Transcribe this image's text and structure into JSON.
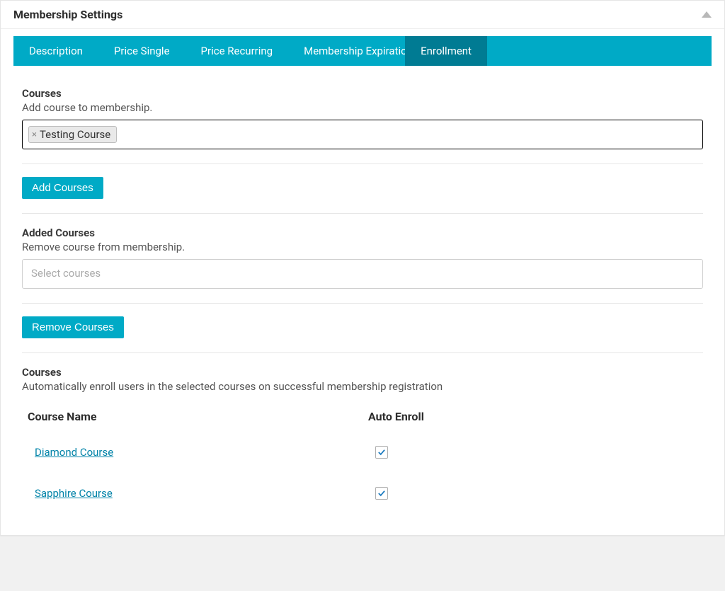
{
  "panel": {
    "title": "Membership Settings"
  },
  "tabs": [
    {
      "label": "Description",
      "active": false
    },
    {
      "label": "Price Single",
      "active": false
    },
    {
      "label": "Price Recurring",
      "active": false
    },
    {
      "label": "Membership Expiration",
      "active": false
    },
    {
      "label": "Enrollment",
      "active": true
    }
  ],
  "courses_section": {
    "heading": "Courses",
    "subtext": "Add course to membership.",
    "tags": [
      "Testing Course"
    ]
  },
  "add_button": "Add Courses",
  "added_courses_section": {
    "heading": "Added Courses",
    "subtext": "Remove course from membership.",
    "placeholder": "Select courses"
  },
  "remove_button": "Remove Courses",
  "auto_enroll_section": {
    "heading": "Courses",
    "subtext": "Automatically enroll users in the selected courses on successful membership registration",
    "columns": {
      "name": "Course Name",
      "enroll": "Auto Enroll"
    },
    "rows": [
      {
        "name": "Diamond Course",
        "checked": true
      },
      {
        "name": "Sapphire Course",
        "checked": true
      }
    ]
  }
}
